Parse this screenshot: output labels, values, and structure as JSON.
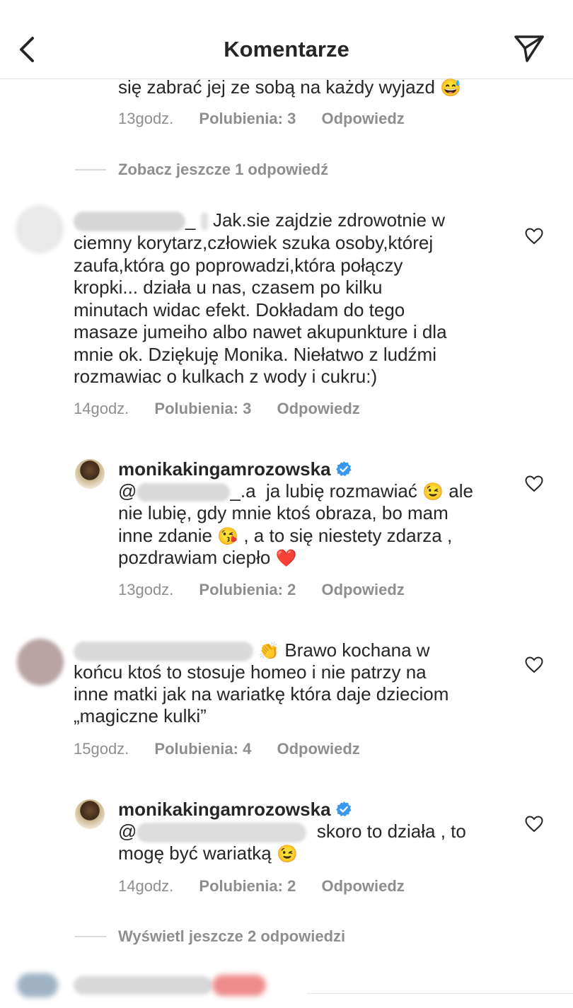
{
  "header": {
    "title": "Komentarze",
    "back_icon": "chevron-left-icon",
    "send_icon": "paper-plane-icon"
  },
  "thread0": {
    "text_tail": "się zabrać jej ze sobą na każdy wyjazd",
    "emoji": "😅",
    "time": "13godz.",
    "likes": "Polubienia: 3",
    "reply": "Odpowiedz"
  },
  "more1": "Zobacz jeszcze 1 odpowiedź",
  "comment1": {
    "handle_tail": "_",
    "lines": [
      "Jak.sie zajdzie zdrowotnie w",
      "ciemny korytarz,człowiek szuka osoby,której",
      "zaufa,która go poprowadzi,która połączy",
      "kropki... działa u nas, czasem po kilku",
      "minutach widac efekt. Dokładam do tego",
      "masaze jumeiho albo nawet akupunkture i dla",
      "mnie ok. Dziękuję Monika. Niełatwo z ludźmi",
      "rozmawiac o kulkach z wody i cukru:)"
    ],
    "time": "14godz.",
    "likes": "Polubienia: 3",
    "reply": "Odpowiedz"
  },
  "reply1": {
    "username": "monikakingamrozowska",
    "mention_prefix": "@",
    "mention_suffix": "_.a",
    "l1": "ja lubię rozmawiać",
    "e1": "😉",
    "l1b": "ale",
    "l2": "nie lubię, gdy mnie ktoś obraza, bo mam",
    "l3a": "inne zdanie",
    "e2": "😘",
    "l3b": ", a to się niestety zdarza ,",
    "l4": "pozdrawiam ciepło",
    "e3": "❤️",
    "time": "13godz.",
    "likes": "Polubienia: 2",
    "reply": "Odpowiedz"
  },
  "comment2": {
    "e1": "👏",
    "l1": "Brawo kochana w",
    "l2": "końcu ktoś to stosuje homeo i nie patrzy na",
    "l3": "inne matki jak na wariatkę która daje dzieciom",
    "l4": "„magiczne kulki”",
    "time": "15godz.",
    "likes": "Polubienia: 4",
    "reply": "Odpowiedz"
  },
  "reply2": {
    "username": "monikakingamrozowska",
    "mention_prefix": "@",
    "l1": "skoro to działa , to",
    "l2": "mogę być wariatką",
    "e1": "😉",
    "time": "14godz.",
    "likes": "Polubienia: 2",
    "reply": "Odpowiedz"
  },
  "more2": "Wyświetl jeszcze 2 odpowiedzi",
  "colors": {
    "text": "#262626",
    "secondary": "#8e8e8e",
    "verified": "#3897f0",
    "divider": "#dbdbdb"
  }
}
